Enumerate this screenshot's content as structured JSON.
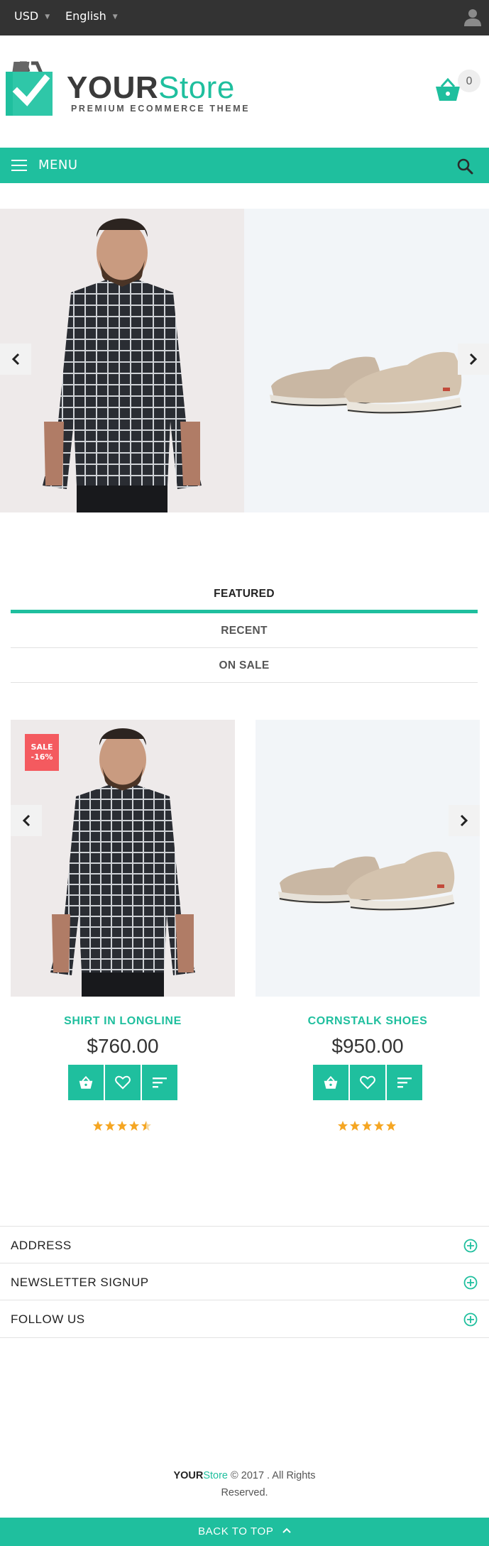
{
  "topbar": {
    "currency": "USD",
    "language": "English",
    "user_icon": "user-icon"
  },
  "header": {
    "logo_your": "YOUR",
    "logo_store": "Store",
    "tagline": "PREMIUM ECOMMERCE THEME",
    "cart_count": "0",
    "cart_icon": "basket-icon"
  },
  "menubar": {
    "label": "MENU",
    "menu_icon": "hamburger-icon",
    "search_icon": "search-icon"
  },
  "tabs": [
    {
      "label": "FEATURED",
      "active": true
    },
    {
      "label": "RECENT",
      "active": false
    },
    {
      "label": "ON SALE",
      "active": false
    }
  ],
  "products": [
    {
      "name": "SHIRT IN LONGLINE",
      "price": "$760.00",
      "badge_line1": "SALE",
      "badge_line2": "-16%",
      "rating": 4.5
    },
    {
      "name": "CORNSTALK SHOES",
      "price": "$950.00",
      "rating": 5
    }
  ],
  "accordion": [
    {
      "label": "ADDRESS"
    },
    {
      "label": "NEWSLETTER SIGNUP"
    },
    {
      "label": "FOLLOW US"
    }
  ],
  "footer": {
    "brand_your": "YOUR",
    "brand_store": "Store",
    "copyright_rest": " © 2017 . All Rights",
    "copyright_line2": "Reserved.",
    "back_to_top": "BACK TO TOP"
  },
  "colors": {
    "accent": "#1fbf9e",
    "topbar": "#333333",
    "sale_badge": "#f45a5f",
    "star": "#f5a623"
  }
}
